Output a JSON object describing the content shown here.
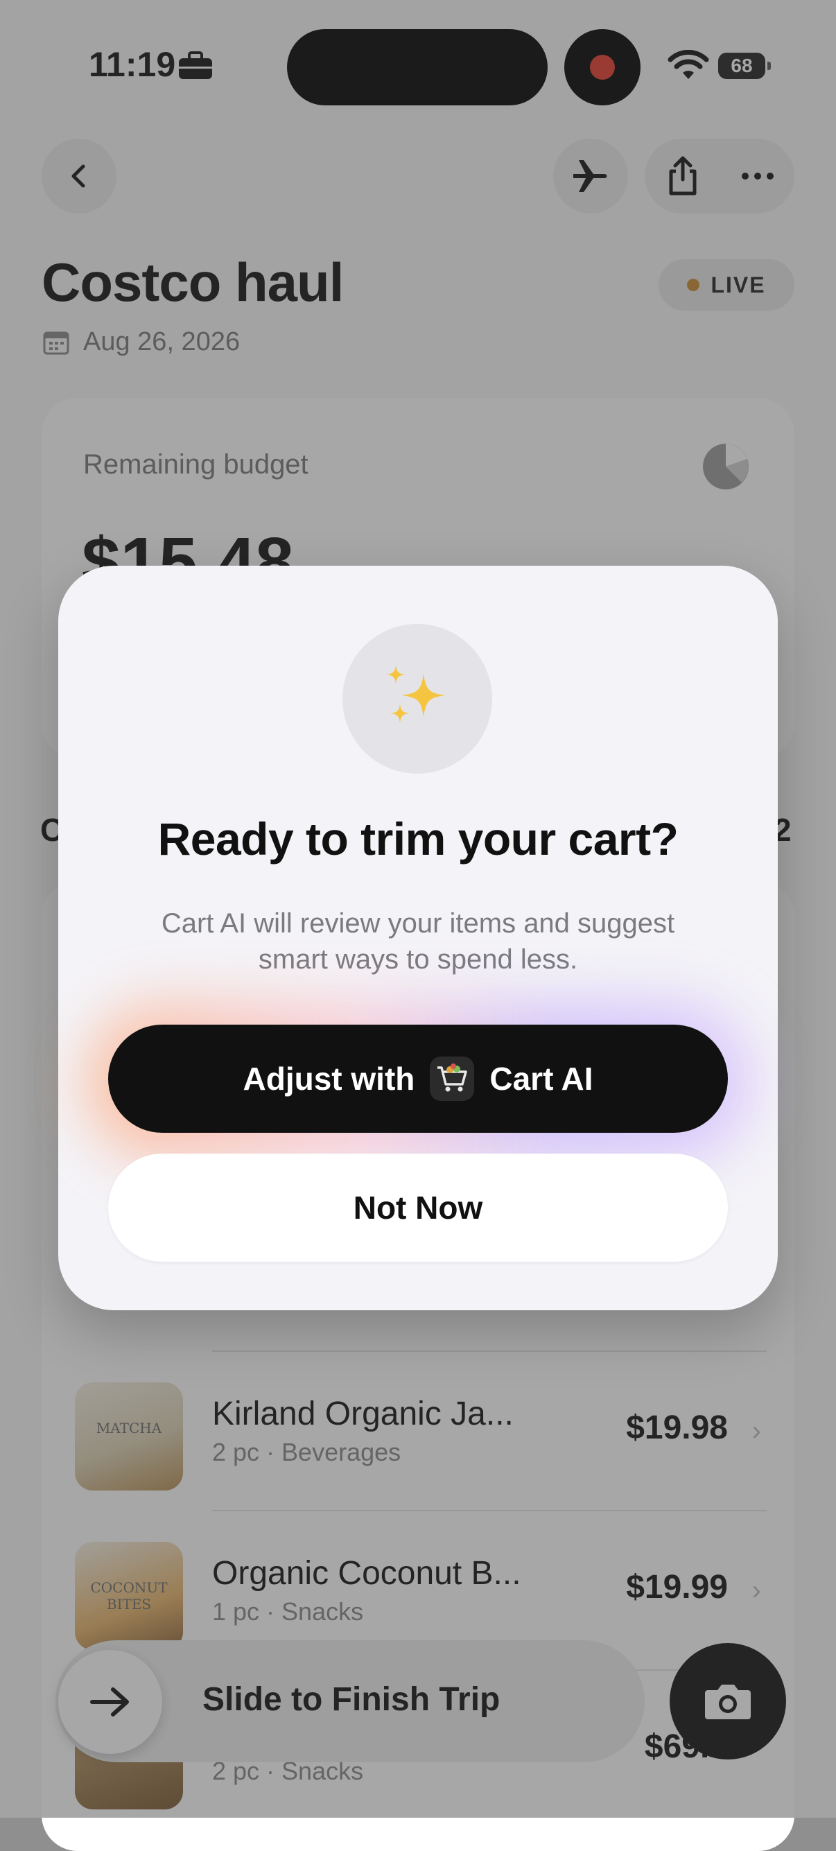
{
  "status_bar": {
    "time": "11:19",
    "battery": "68"
  },
  "header": {
    "title": "Costco haul",
    "date": "Aug 26, 2026",
    "live_label": "LIVE"
  },
  "budget": {
    "label": "Remaining budget",
    "value": "$15.48"
  },
  "section": {
    "left_label": "C",
    "right_label": "2"
  },
  "items": [
    {
      "name": "Kirland Organic Ja...",
      "meta": "2 pc · Beverages",
      "price": "$19.98"
    },
    {
      "name": "Organic Coconut B...",
      "meta": "1 pc · Snacks",
      "price": "$19.99"
    },
    {
      "name": "",
      "meta": "2 pc · Snacks",
      "price": "$69.9"
    }
  ],
  "slide": {
    "label": "Slide to Finish Trip"
  },
  "modal": {
    "title": "Ready to trim your cart?",
    "body": "Cart AI will review your items and suggest smart ways to spend less.",
    "primary_prefix": "Adjust with",
    "primary_suffix": "Cart AI",
    "secondary": "Not Now"
  },
  "colors": {
    "accent_dark": "#111111",
    "live_dot": "#c98a2e",
    "record": "#e53b2c",
    "sparkle": "#f5c542"
  }
}
